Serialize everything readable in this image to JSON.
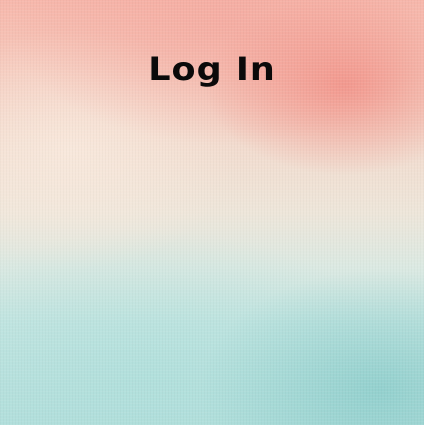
{
  "page": {
    "title": "Log In"
  },
  "colors": {
    "title_text": "#0a0a0a",
    "background_top": "#f7b8ac",
    "background_middle": "#eee6da",
    "background_bottom": "#b4dfdc"
  }
}
